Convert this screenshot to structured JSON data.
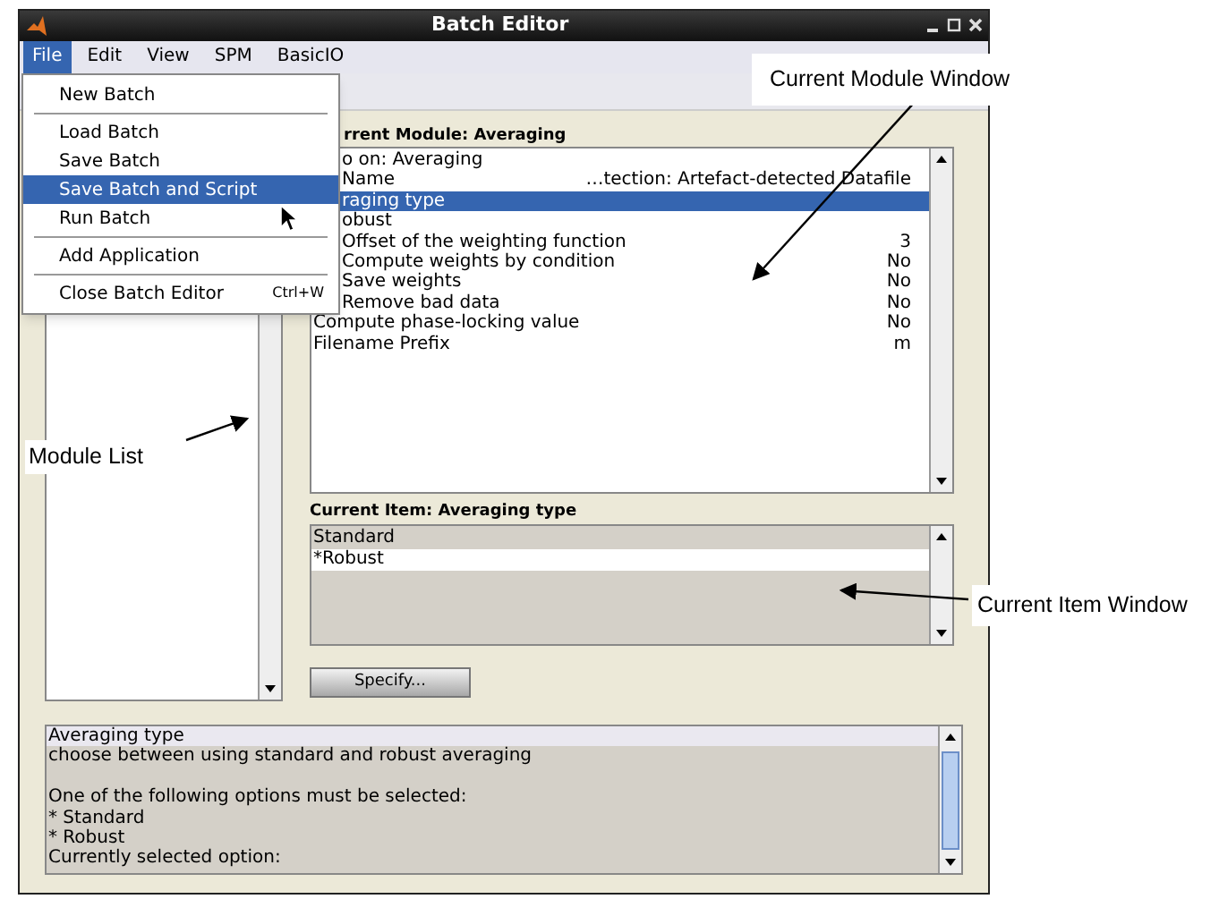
{
  "window": {
    "title": "Batch Editor"
  },
  "menu_bar": [
    {
      "label": "File",
      "selected": true
    },
    {
      "label": "Edit",
      "selected": false
    },
    {
      "label": "View",
      "selected": false
    },
    {
      "label": "SPM",
      "selected": false
    },
    {
      "label": "BasicIO",
      "selected": false
    }
  ],
  "file_menu": {
    "items": [
      {
        "label": "New Batch",
        "selected": false,
        "divider_before": false
      },
      {
        "label": "Load Batch",
        "selected": false,
        "divider_before": true
      },
      {
        "label": "Save Batch",
        "selected": false,
        "divider_before": false
      },
      {
        "label": "Save Batch and Script",
        "selected": true,
        "divider_before": false
      },
      {
        "label": "Run Batch",
        "selected": false,
        "divider_before": false
      },
      {
        "label": "Add Application",
        "selected": false,
        "divider_before": true
      },
      {
        "label": "Close Batch Editor",
        "shortcut": "Ctrl+W",
        "selected": false,
        "divider_before": true
      }
    ]
  },
  "current_module": {
    "label": "rrent Module: Averaging",
    "rows": [
      {
        "name": "o on: Averaging",
        "covered": true,
        "selected": false
      },
      {
        "name": "Name",
        "value": "…tection: Artefact-detected Datafile",
        "covered": true,
        "selected": false
      },
      {
        "name": "raging type",
        "covered": true,
        "selected": true
      },
      {
        "name": "obust",
        "covered": true,
        "selected": false
      },
      {
        "name": "Offset of the weighting function",
        "value": "3",
        "covered": true,
        "selected": false
      },
      {
        "name": "Compute weights by condition",
        "value": "No",
        "covered": true,
        "selected": false
      },
      {
        "name": "Save weights",
        "value": "No",
        "covered": true,
        "selected": false
      },
      {
        "name": "Remove bad data",
        "value": "No",
        "covered": true,
        "selected": false
      },
      {
        "name": "Compute phase-locking value",
        "value": "No",
        "covered": false,
        "selected": false
      },
      {
        "name": "Filename Prefix",
        "value": "m",
        "covered": false,
        "selected": false
      }
    ]
  },
  "current_item": {
    "label": "Current Item: Averaging type",
    "options": [
      {
        "label": "Standard",
        "selected": false
      },
      {
        "label": "*Robust",
        "selected": true
      }
    ]
  },
  "specify_button": "Specify...",
  "help": {
    "lines": [
      {
        "text": "Averaging type",
        "kind": "heading",
        "blank_before": false
      },
      {
        "text": "choose between using standard and robust averaging",
        "kind": "text",
        "blank_before": false
      },
      {
        "text": "One of the following options must be selected:",
        "kind": "text",
        "blank_before": true
      },
      {
        "text": "* Standard",
        "kind": "text",
        "blank_before": false
      },
      {
        "text": "* Robust",
        "kind": "text",
        "blank_before": false
      },
      {
        "text": "Currently selected option:",
        "kind": "text",
        "blank_before": false
      }
    ]
  },
  "annotations": [
    {
      "text": "Current Module Window"
    },
    {
      "text": "Module List"
    },
    {
      "text": "Current Item Window"
    }
  ]
}
